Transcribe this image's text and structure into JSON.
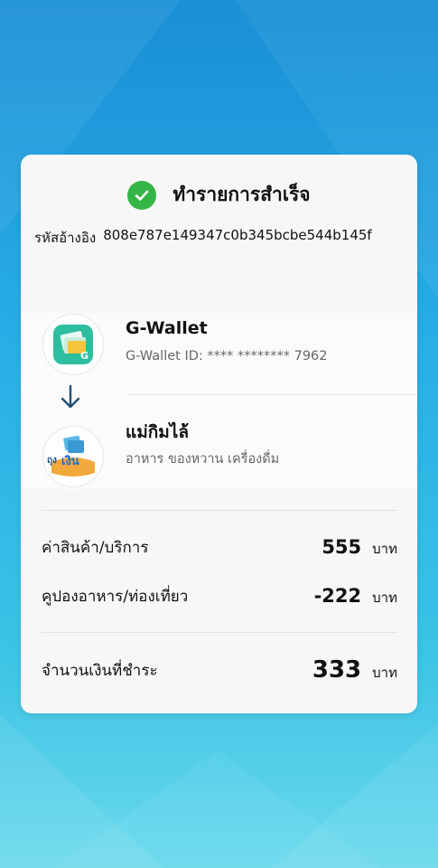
{
  "status": {
    "title": "ทำรายการสำเร็จ",
    "icon": "check-circle-icon",
    "color": "#35b545"
  },
  "reference": {
    "label": "รหัสอ้างอิง",
    "value": "808e787e149347c0b345bcbe544b145f"
  },
  "payer": {
    "name": "G-Wallet",
    "detail": "G-Wallet ID: **** ********   7962",
    "logo_icon": "g-wallet-app-icon",
    "logo_letter": "G"
  },
  "payee": {
    "name": "แม่กิมไล้",
    "detail": "อาหาร ของหวาน เครื่องดื่ม",
    "logo_icon": "thung-ngoen-logo",
    "logo_text_a": "ถุง",
    "logo_text_b": "เงิน"
  },
  "lines": [
    {
      "label": "ค่าสินค้า/บริการ",
      "amount": "555",
      "unit": "บาท"
    },
    {
      "label": "คูปองอาหาร/ท่องเที่ยว",
      "amount": "-222",
      "unit": "บาท"
    }
  ],
  "total": {
    "label": "จำนวนเงินที่ชำระ",
    "amount": "333",
    "unit": "บาท"
  }
}
